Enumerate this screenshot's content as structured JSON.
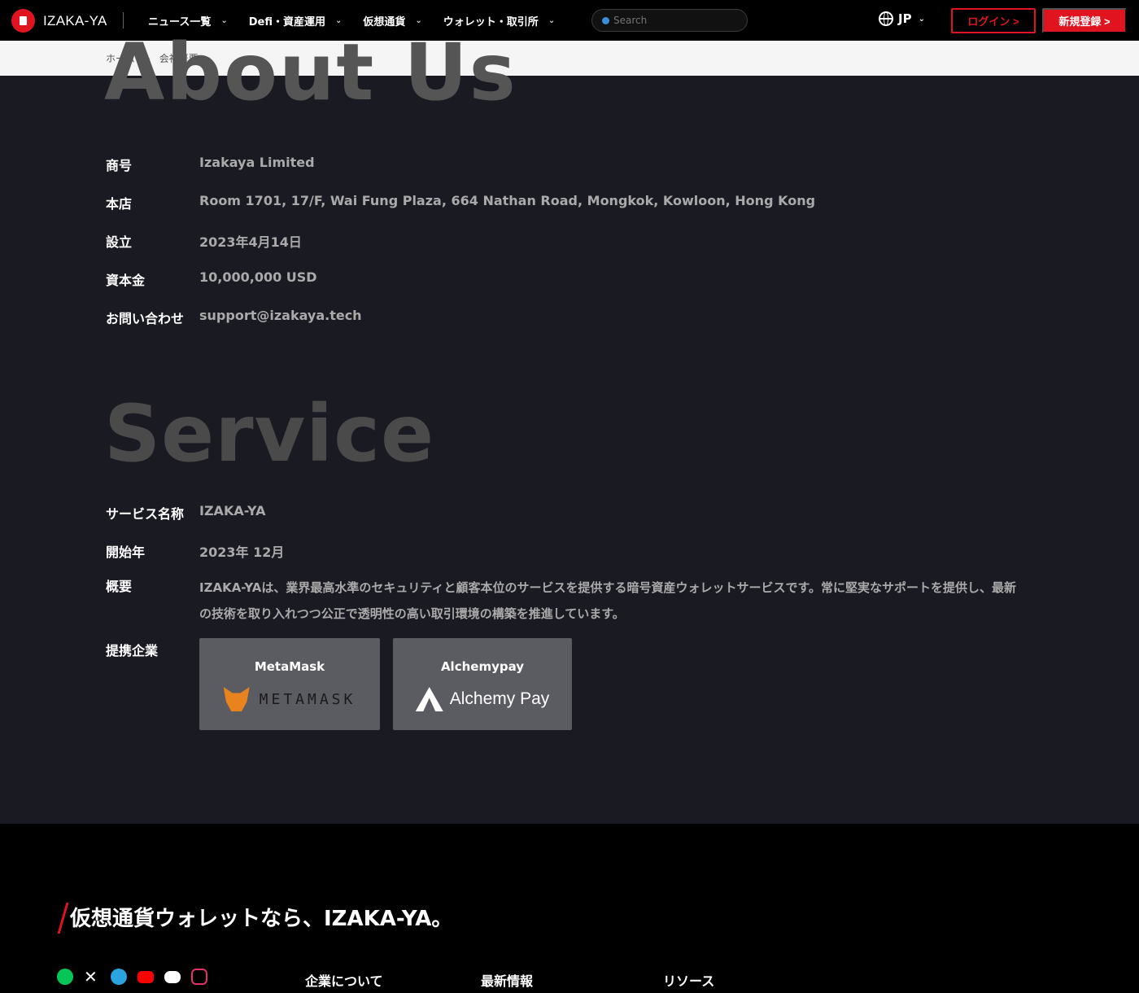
{
  "header": {
    "brand": "IZAKA-YA",
    "nav": [
      {
        "label": "ニュース一覧"
      },
      {
        "label": "Defi・資産運用"
      },
      {
        "label": "仮想通貨"
      },
      {
        "label": "ウォレット・取引所"
      }
    ],
    "search_placeholder": "Search",
    "language": "JP",
    "login": "ログイン >",
    "signup": "新規登録 >"
  },
  "breadcrumb": {
    "home": "ホーム",
    "separator": ">",
    "current": "会社概要"
  },
  "about": {
    "title": "About Us",
    "rows": [
      {
        "label": "商号",
        "value": "Izakaya Limited"
      },
      {
        "label": "本店",
        "value": "Room 1701, 17/F, Wai Fung Plaza, 664 Nathan Road, Mongkok, Kowloon, Hong Kong"
      },
      {
        "label": "設立",
        "value": "2023年4月14日"
      },
      {
        "label": "資本金",
        "value": "10,000,000 USD"
      },
      {
        "label": "お問い合わせ",
        "value": "support@izakaya.tech"
      }
    ]
  },
  "service": {
    "title": "Service",
    "rows": [
      {
        "label": "サービス名称",
        "value": "IZAKA-YA"
      },
      {
        "label": "開始年",
        "value": "2023年 12月"
      }
    ],
    "overview_label": "概要",
    "overview": "IZAKA-YAは、業界最高水準のセキュリティと顧客本位のサービスを提供する暗号資産ウォレットサービスです。常に堅実なサポートを提供し、最新の技術を取り入れつつ公正で透明性の高い取引環境の構築を推進しています。",
    "partners_label": "提携企業",
    "partners": [
      {
        "name": "MetaMask",
        "logo_text": "METAMASK"
      },
      {
        "name": "Alchemypay",
        "logo_text": "Alchemy Pay"
      }
    ]
  },
  "footer": {
    "tagline": "仮想通貨ウォレットなら、IZAKA-YA。",
    "socials": [
      {
        "icon": "line-icon",
        "color": "#06c755"
      },
      {
        "icon": "x-icon",
        "color": "#ffffff"
      },
      {
        "icon": "telegram-icon",
        "color": "#2aa3df"
      },
      {
        "icon": "youtube-icon",
        "color": "#ff0000"
      },
      {
        "icon": "discord-icon",
        "color": "#ffffff"
      },
      {
        "icon": "instagram-icon",
        "color": "#e1306c"
      }
    ],
    "columns": [
      "企業について",
      "最新情報",
      "リソース"
    ]
  },
  "colors": {
    "accent": "#e0141e",
    "background": "#1a1a22",
    "footer": "#000000"
  }
}
